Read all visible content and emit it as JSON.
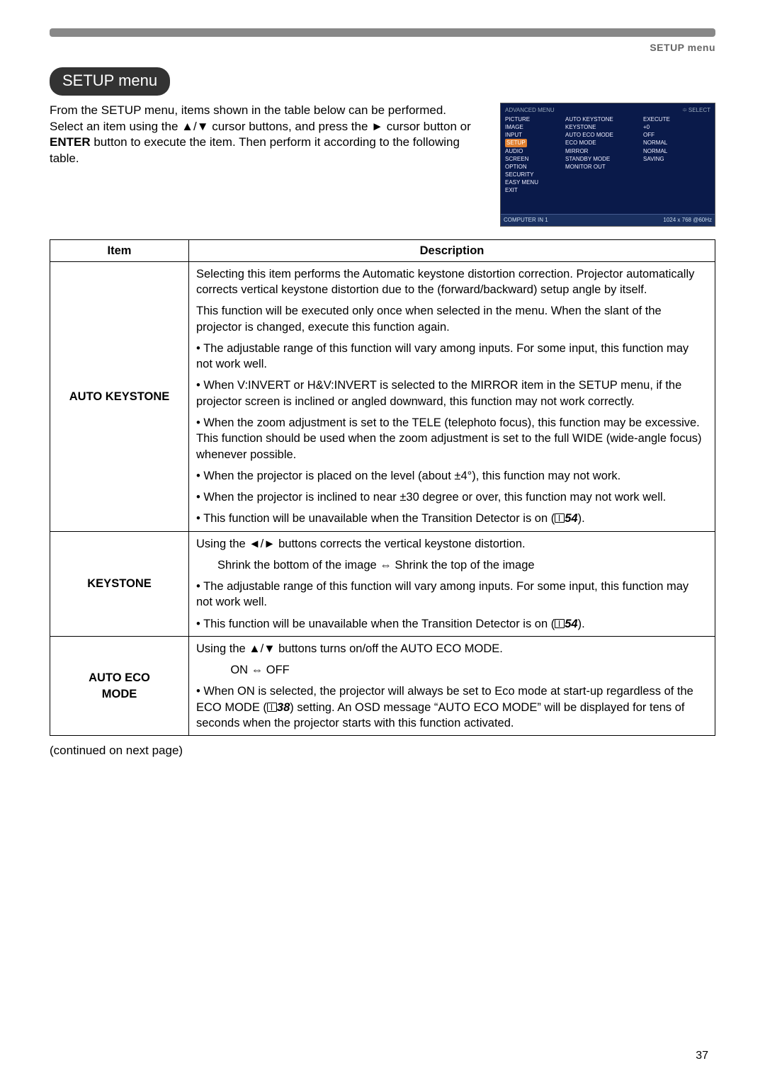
{
  "breadcrumb": "SETUP menu",
  "pill": "SETUP menu",
  "intro": "From the SETUP menu, items shown in the table below can be performed.\nSelect an item using the ▲/▼ cursor buttons, and press the ► cursor button or ENTER button to execute the item. Then perform it according to the following table.",
  "osd": {
    "title": "ADVANCED MENU",
    "select": "SELECT",
    "left": [
      "PICTURE",
      "IMAGE",
      "INPUT",
      "SETUP",
      "AUDIO",
      "SCREEN",
      "OPTION",
      "SECURITY",
      "EASY MENU",
      "EXIT"
    ],
    "mid": [
      "AUTO KEYSTONE",
      "KEYSTONE",
      "AUTO ECO MODE",
      "ECO MODE",
      "MIRROR",
      "STANDBY MODE",
      "MONITOR OUT"
    ],
    "right": [
      "EXECUTE",
      "+0",
      "OFF",
      "NORMAL",
      "NORMAL",
      "SAVING",
      ""
    ],
    "foot_left": "COMPUTER IN 1",
    "foot_right": "1024 x 768 @60Hz"
  },
  "table": {
    "head_item": "Item",
    "head_desc": "Description",
    "rows": [
      {
        "item": "AUTO KEYSTONE",
        "desc": [
          "Selecting this item performs the Automatic keystone distortion correction. Projector automatically corrects vertical keystone distortion due to the (forward/backward) setup angle by itself.",
          "This function will be executed only once when selected in the menu. When the slant of the projector is changed, execute this function again.",
          "• The adjustable range of this function will vary among inputs. For some input, this function may not work well.",
          "• When V:INVERT or H&V:INVERT is selected to the MIRROR item in the SETUP menu, if the projector screen is inclined or angled downward, this function may not work correctly.",
          "• When the zoom adjustment is set to the TELE (telephoto focus), this function may be excessive. This function should be used when the zoom adjustment is set to the full WIDE (wide-angle focus) whenever possible.",
          "• When the projector is placed on the level (about ±4°), this function may not work.",
          "• When the projector is inclined to near ±30 degree or over, this function may not work well.",
          "• This function will be unavailable when the Transition Detector is on ({ICON}54)."
        ]
      },
      {
        "item": "KEYSTONE",
        "desc": [
          "Using the ◄/► buttons corrects the vertical keystone distortion.",
          "Shrink the bottom of the image ⇔ Shrink the top of the image",
          "• The adjustable range of this function will vary among inputs. For some input, this function may not work well.",
          "• This function will be unavailable when the Transition Detector is on ({ICON}54)."
        ]
      },
      {
        "item": "AUTO ECO MODE",
        "desc": [
          "Using the ▲/▼ buttons turns on/off the AUTO ECO MODE.",
          "ON ⇔ OFF",
          "• When ON is selected, the projector will always be set to Eco mode at start-up regardless of the ECO MODE ({ICON}38) setting. An OSD message “AUTO ECO MODE” will be displayed for tens of seconds when the projector starts with this function activated."
        ]
      }
    ]
  },
  "continued": "(continued on next page)",
  "pagenum": "37"
}
